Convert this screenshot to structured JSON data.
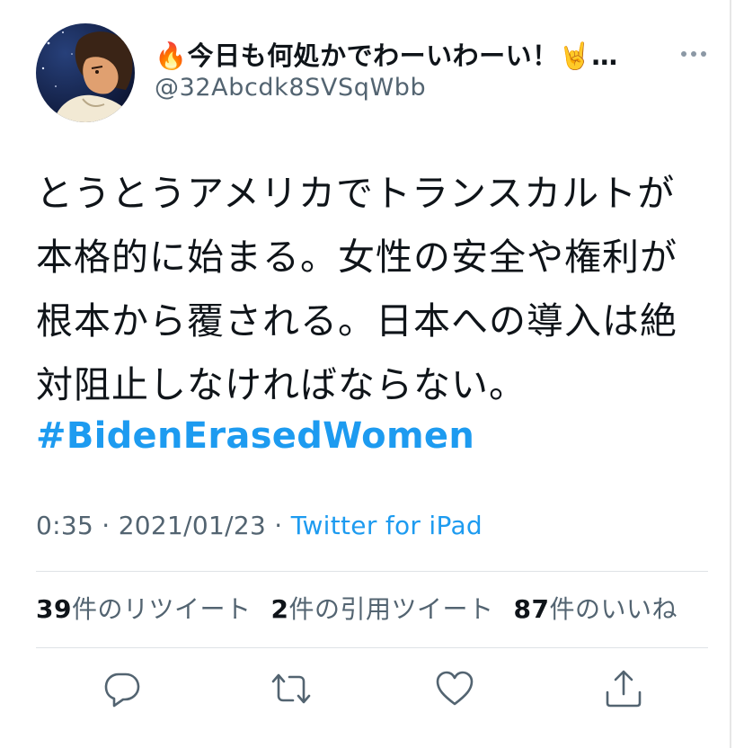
{
  "tweet": {
    "author": {
      "display_name": "🔥今日も何処かでわーいわーい！🤘…",
      "handle": "@32Abcdk8SVSqWbb"
    },
    "body_lines": [
      "とうとうアメリカでトランスカルトが",
      "本格的に始まる。女性の安全や権利が",
      "根本から覆される。日本への導入は絶",
      "対阻止しなければならない。"
    ],
    "hashtag": "#BidenErasedWomen",
    "meta": {
      "time": "0:35",
      "sep1": " · ",
      "date": "2021/01/23",
      "sep2": " · ",
      "source": "Twitter for iPad"
    },
    "stats": {
      "retweets_count": "39",
      "retweets_label": "件のリツイート",
      "quotes_count": "2",
      "quotes_label": "件の引用ツイート",
      "likes_count": "87",
      "likes_label": "件のいいね"
    }
  },
  "icons": {
    "more": "more-dots-icon",
    "reply": "reply-icon",
    "retweet": "retweet-icon",
    "like": "heart-icon",
    "share": "share-icon"
  },
  "colors": {
    "link": "#1d9bf0",
    "secondary_text": "#536471",
    "primary_text": "#0f1419"
  }
}
